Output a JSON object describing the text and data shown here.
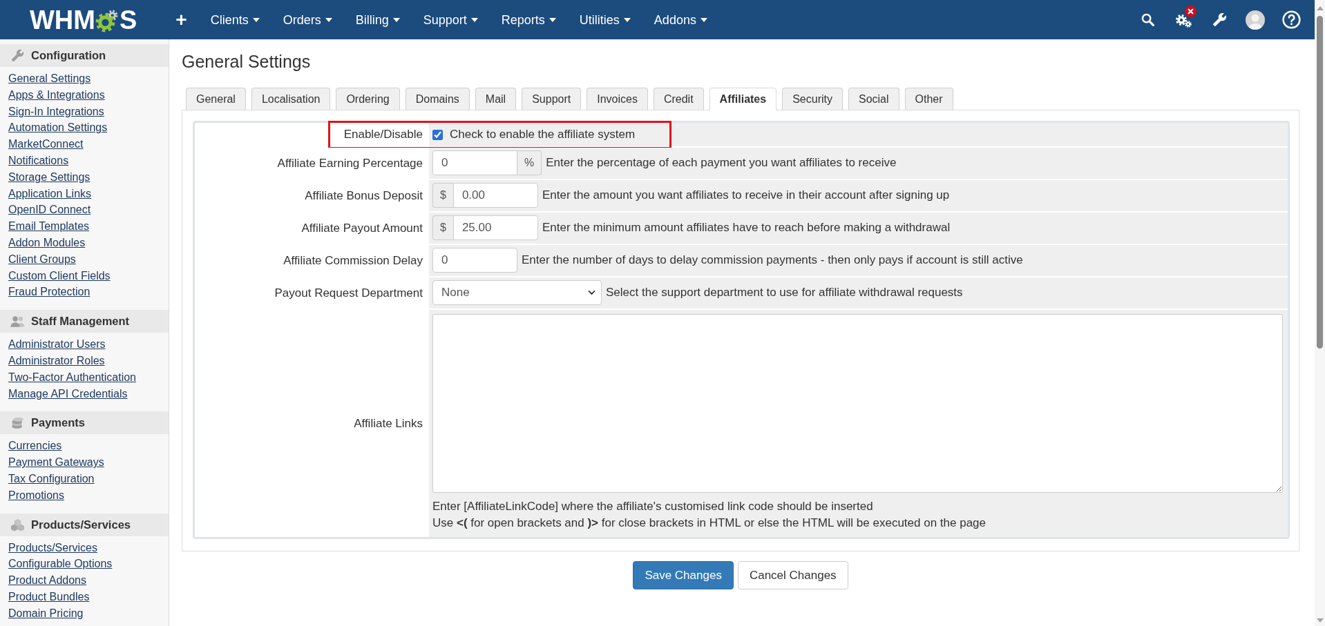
{
  "navbar": {
    "logo": [
      "WHM",
      "S"
    ],
    "menu": [
      {
        "label": "+",
        "kind": "action"
      },
      {
        "label": "Clients",
        "kind": "dropdown"
      },
      {
        "label": "Orders",
        "kind": "dropdown"
      },
      {
        "label": "Billing",
        "kind": "dropdown"
      },
      {
        "label": "Support",
        "kind": "dropdown"
      },
      {
        "label": "Reports",
        "kind": "dropdown"
      },
      {
        "label": "Utilities",
        "kind": "dropdown"
      },
      {
        "label": "Addons",
        "kind": "dropdown"
      }
    ],
    "alert": true
  },
  "sidebar": {
    "sections": [
      {
        "title": "Configuration",
        "kind": "wrench",
        "items": [
          "General Settings",
          "Apps & Integrations",
          "Sign-In Integrations",
          "Automation Settings",
          "MarketConnect",
          "Notifications",
          "Storage Settings",
          "Application Links",
          "OpenID Connect",
          "Email Templates",
          "Addon Modules",
          "Client Groups",
          "Custom Client Fields",
          "Fraud Protection"
        ]
      },
      {
        "title": "Staff Management",
        "kind": "people",
        "items": [
          "Administrator Users",
          "Administrator Roles",
          "Two-Factor Authentication",
          "Manage API Credentials"
        ]
      },
      {
        "title": "Payments",
        "kind": "coins",
        "items": [
          "Currencies",
          "Payment Gateways",
          "Tax Configuration",
          "Promotions"
        ]
      },
      {
        "title": "Products/Services",
        "kind": "cubes",
        "items": [
          "Products/Services",
          "Configurable Options",
          "Product Addons",
          "Product Bundles",
          "Domain Pricing"
        ]
      }
    ]
  },
  "page": {
    "title": "General Settings",
    "tabs": [
      {
        "label": "General",
        "selected": false
      },
      {
        "label": "Localisation",
        "selected": false
      },
      {
        "label": "Ordering",
        "selected": false
      },
      {
        "label": "Domains",
        "selected": false
      },
      {
        "label": "Mail",
        "selected": false
      },
      {
        "label": "Support",
        "selected": false
      },
      {
        "label": "Invoices",
        "selected": false
      },
      {
        "label": "Credit",
        "selected": false
      },
      {
        "label": "Affiliates",
        "selected": true
      },
      {
        "label": "Security",
        "selected": false
      },
      {
        "label": "Social",
        "selected": false
      },
      {
        "label": "Other",
        "selected": false
      }
    ],
    "settings": [
      {
        "label": "Enable/Disable",
        "kind": "checkbox",
        "checked": true,
        "text": "Check to enable the affiliate system",
        "highlighted": true
      },
      {
        "label": "Affiliate Earning Percentage",
        "kind": "input",
        "value": "0",
        "suffix": "%",
        "help": [
          "Enter the percentage of each payment you want affiliates to receive"
        ],
        "highlighted": false
      },
      {
        "label": "Affiliate Bonus Deposit",
        "kind": "input",
        "prefix": "$",
        "value": "0.00",
        "help": [
          "Enter the amount you want affiliates to receive in their account after signing up"
        ],
        "highlighted": false
      },
      {
        "label": "Affiliate Payout Amount",
        "kind": "input",
        "prefix": "$",
        "value": "25.00",
        "help": [
          "Enter the minimum amount affiliates have to reach before making a withdrawal"
        ],
        "highlighted": false
      },
      {
        "label": "Affiliate Commission Delay",
        "kind": "input",
        "value": "0",
        "help": [
          "Enter the number of days to delay commission payments - then only pays if account is still active"
        ],
        "highlighted": false
      },
      {
        "label": "Payout Request Department",
        "kind": "select",
        "value": "None",
        "help": [
          "Select the support department to use for affiliate withdrawal requests"
        ],
        "highlighted": false
      },
      {
        "label": "Affiliate Links",
        "kind": "textarea",
        "help": [
          "Enter [AffiliateLinkCode] where the affiliate's customised link code should be inserted",
          "Use **<(** for open brackets and **)>** for close brackets in HTML or else the HTML will be executed on the page"
        ],
        "highlighted": false
      }
    ],
    "buttons": [
      {
        "label": "Save Changes",
        "kind": "primary"
      },
      {
        "label": "Cancel Changes",
        "kind": "default"
      }
    ]
  }
}
